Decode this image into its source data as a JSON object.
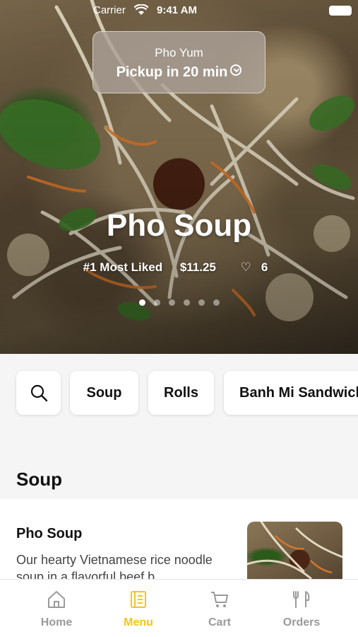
{
  "status_bar": {
    "carrier": "Carrier",
    "time": "9:41 AM"
  },
  "pickup": {
    "store_name": "Pho Yum",
    "pickup_text": "Pickup in 20 min"
  },
  "hero": {
    "title": "Pho Soup",
    "badge": "#1 Most Liked",
    "price": "$11.25",
    "likes": "6",
    "carousel": {
      "count": 6,
      "active_index": 0
    }
  },
  "categories": [
    "Soup",
    "Rolls",
    "Banh Mi Sandwiches"
  ],
  "section": {
    "title": "Soup"
  },
  "items": [
    {
      "name": "Pho Soup",
      "description": "Our hearty Vietnamese rice noodle soup in a flavorful beef b..."
    }
  ],
  "tabs": [
    {
      "label": "Home",
      "icon": "home-icon",
      "active": false
    },
    {
      "label": "Menu",
      "icon": "menu-icon",
      "active": true
    },
    {
      "label": "Cart",
      "icon": "cart-icon",
      "active": false
    },
    {
      "label": "Orders",
      "icon": "orders-icon",
      "active": false
    }
  ],
  "colors": {
    "accent": "#f5c518",
    "inactive_tab": "#9a9a9a"
  }
}
